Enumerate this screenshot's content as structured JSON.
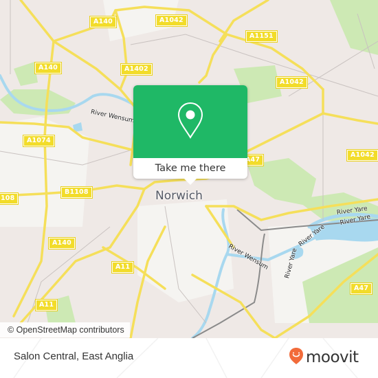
{
  "map": {
    "city_label": "Norwich",
    "road_labels": [
      {
        "id": "a140-top",
        "text": "A140"
      },
      {
        "id": "a1042-top",
        "text": "A1042"
      },
      {
        "id": "a1151",
        "text": "A1151"
      },
      {
        "id": "a140-left",
        "text": "A140"
      },
      {
        "id": "a1402",
        "text": "A1402"
      },
      {
        "id": "a1042-right",
        "text": "A1042"
      },
      {
        "id": "a1042-east",
        "text": "A1042"
      },
      {
        "id": "a1074",
        "text": "A1074"
      },
      {
        "id": "a47-mid",
        "text": "A47"
      },
      {
        "id": "b1108",
        "text": "B1108"
      },
      {
        "id": "b1108-left",
        "text": "108"
      },
      {
        "id": "a140-bottom",
        "text": "A140"
      },
      {
        "id": "a11-mid",
        "text": "A11"
      },
      {
        "id": "a11-left",
        "text": "A11"
      },
      {
        "id": "a47-east",
        "text": "A47"
      }
    ],
    "river_labels": [
      {
        "id": "wensum-north",
        "text": "River Wensum"
      },
      {
        "id": "wensum-south",
        "text": "River Wensum"
      },
      {
        "id": "yare-1",
        "text": "River Yare"
      },
      {
        "id": "yare-2",
        "text": "River Yare"
      },
      {
        "id": "yare-3",
        "text": "River Yare"
      },
      {
        "id": "yare-4",
        "text": "River Yare"
      }
    ],
    "colors": {
      "land": "#efe9e6",
      "park": "#cde9b4",
      "water": "#a8d8ef",
      "road": "#f5df5a",
      "popup_green": "#1fb866"
    }
  },
  "popup": {
    "icon": "location-pin-icon",
    "button_label": "Take me there"
  },
  "attribution": "© OpenStreetMap contributors",
  "footer": {
    "place_title": "Salon Central, East Anglia",
    "brand_name": "moovit",
    "brand_icon": "moovit-smile-pin-icon",
    "brand_color": "#f26b3a"
  }
}
